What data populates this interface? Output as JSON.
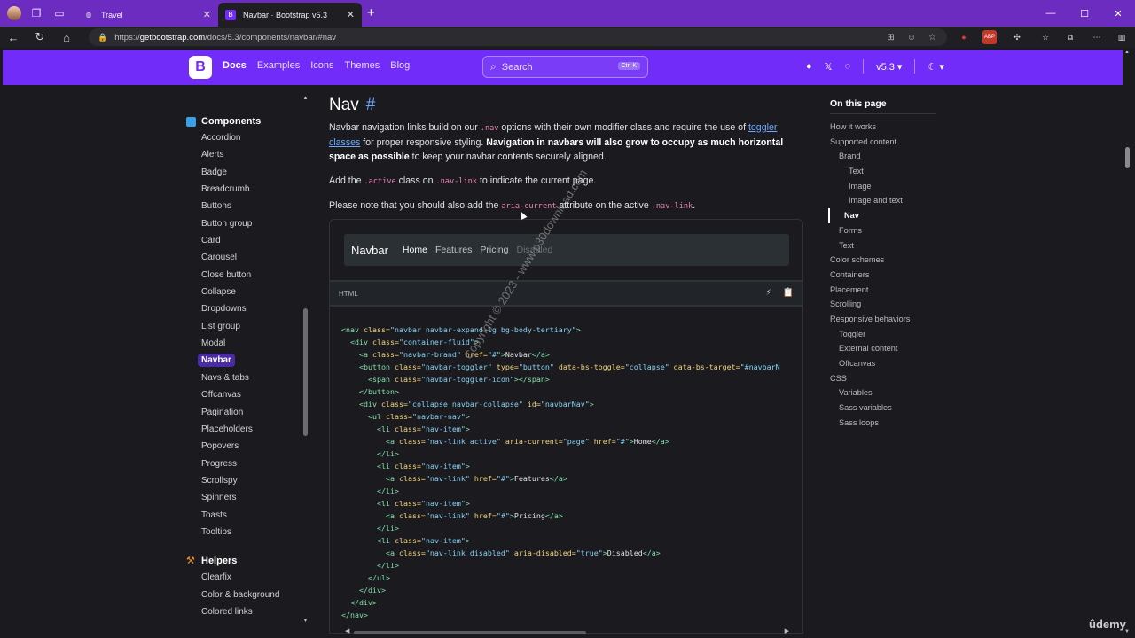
{
  "browser": {
    "tabs": [
      {
        "title": "Travel",
        "active": false
      },
      {
        "title": "Navbar · Bootstrap v5.3",
        "active": true
      }
    ],
    "url_scheme": "https://",
    "url_host": "getbootstrap.com",
    "url_path": "/docs/5.3/components/navbar/#nav"
  },
  "bsnav": {
    "logo": "B",
    "links": [
      "Docs",
      "Examples",
      "Icons",
      "Themes",
      "Blog"
    ],
    "search_placeholder": "Search",
    "search_shortcut": "Ctrl K",
    "version": "v5.3"
  },
  "sidebar": {
    "components_heading": "Components",
    "components": [
      "Accordion",
      "Alerts",
      "Badge",
      "Breadcrumb",
      "Buttons",
      "Button group",
      "Card",
      "Carousel",
      "Close button",
      "Collapse",
      "Dropdowns",
      "List group",
      "Modal",
      "Navbar",
      "Navs & tabs",
      "Offcanvas",
      "Pagination",
      "Placeholders",
      "Popovers",
      "Progress",
      "Scrollspy",
      "Spinners",
      "Toasts",
      "Tooltips"
    ],
    "active_item": "Navbar",
    "helpers_heading": "Helpers",
    "helpers": [
      "Clearfix",
      "Color & background",
      "Colored links"
    ]
  },
  "main": {
    "heading": "Nav",
    "anchor": "#",
    "p1_a": "Navbar navigation links build on our ",
    "p1_code": ".nav",
    "p1_b": " options with their own modifier class and require the use of ",
    "p1_link": "toggler classes",
    "p1_c": " for proper responsive styling. ",
    "p1_bold": "Navigation in navbars will also grow to occupy as much horizontal space as possible",
    "p1_d": " to keep your navbar contents securely aligned.",
    "p2_a": "Add the ",
    "p2_code1": ".active",
    "p2_b": " class on ",
    "p2_code2": ".nav-link",
    "p2_c": " to indicate the current page.",
    "p3_a": "Please note that you should also add the ",
    "p3_code1": "aria-current",
    "p3_b": " attribute on the active ",
    "p3_code2": ".nav-link",
    "p3_c": ".",
    "demo": {
      "brand": "Navbar",
      "links": [
        "Home",
        "Features",
        "Pricing",
        "Disabled"
      ]
    },
    "code_lang": "HTML"
  },
  "toc": {
    "title": "On this page",
    "items": [
      {
        "label": "How it works",
        "level": 1
      },
      {
        "label": "Supported content",
        "level": 1
      },
      {
        "label": "Brand",
        "level": 2
      },
      {
        "label": "Text",
        "level": 3
      },
      {
        "label": "Image",
        "level": 3
      },
      {
        "label": "Image and text",
        "level": 3
      },
      {
        "label": "Nav",
        "level": 2,
        "active": true
      },
      {
        "label": "Forms",
        "level": 2
      },
      {
        "label": "Text",
        "level": 2
      },
      {
        "label": "Color schemes",
        "level": 1
      },
      {
        "label": "Containers",
        "level": 1
      },
      {
        "label": "Placement",
        "level": 1
      },
      {
        "label": "Scrolling",
        "level": 1
      },
      {
        "label": "Responsive behaviors",
        "level": 1
      },
      {
        "label": "Toggler",
        "level": 2
      },
      {
        "label": "External content",
        "level": 2
      },
      {
        "label": "Offcanvas",
        "level": 2
      },
      {
        "label": "CSS",
        "level": 1
      },
      {
        "label": "Variables",
        "level": 2
      },
      {
        "label": "Sass variables",
        "level": 2
      },
      {
        "label": "Sass loops",
        "level": 2
      }
    ]
  },
  "overlay": {
    "watermark": "Copyright © 2023 - www.p30download.com",
    "udemy": "ûdemy"
  },
  "colors": {
    "bootstrap_purple": "#712cf9",
    "tabstrip": "#6d2cc0"
  }
}
